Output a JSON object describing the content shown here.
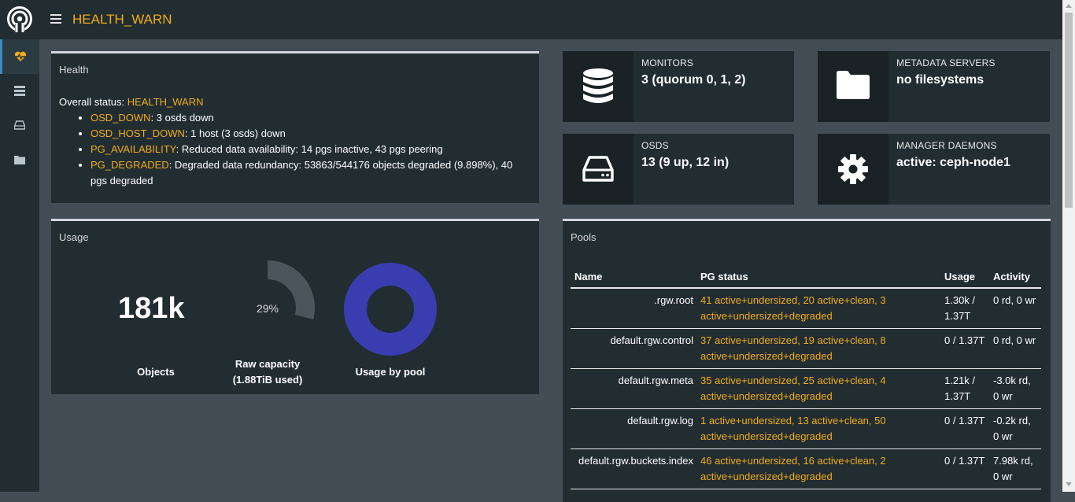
{
  "header": {
    "status": "HEALTH_WARN"
  },
  "sidebar": {
    "items": [
      {
        "name": "dashboard",
        "icon": "heartbeat-icon"
      },
      {
        "name": "servers",
        "icon": "server-icon"
      },
      {
        "name": "storage",
        "icon": "hdd-icon"
      },
      {
        "name": "filesystems",
        "icon": "folder-icon"
      }
    ]
  },
  "health": {
    "title": "Health",
    "overall_label": "Overall status: ",
    "overall_value": "HEALTH_WARN",
    "checks": [
      {
        "code": "OSD_DOWN",
        "message": ": 3 osds down"
      },
      {
        "code": "OSD_HOST_DOWN",
        "message": ": 1 host (3 osds) down"
      },
      {
        "code": "PG_AVAILABILITY",
        "message": ": Reduced data availability: 14 pgs inactive, 43 pgs peering"
      },
      {
        "code": "PG_DEGRADED",
        "message": ": Degraded data redundancy: 53863/544176 objects degraded (9.898%), 40 pgs degraded"
      }
    ]
  },
  "stats": {
    "monitors": {
      "label": "MONITORS",
      "value": "3 (quorum 0, 1, 2)"
    },
    "mds": {
      "label": "METADATA SERVERS",
      "value": "no filesystems"
    },
    "osds": {
      "label": "OSDS",
      "value": "13 (9 up, 12 in)"
    },
    "mgr": {
      "label": "MANAGER DAEMONS",
      "value": "active: ceph-node1"
    }
  },
  "usage": {
    "title": "Usage",
    "objects_value": "181k",
    "objects_label": "Objects",
    "raw_capacity_percent_text": "29%",
    "raw_capacity_fraction": 0.29,
    "raw_capacity_label_line1": "Raw capacity",
    "raw_capacity_label_line2": "(1.88TiB used)",
    "pool_label": "Usage by pool"
  },
  "pools": {
    "title": "Pools",
    "columns": [
      "Name",
      "PG status",
      "Usage",
      "Activity"
    ],
    "rows": [
      {
        "name": ".rgw.root",
        "pg": "41 active+undersized, 20 active+clean, 3 active+undersized+degraded",
        "usage": "1.30k / 1.37T",
        "activity": "0 rd, 0 wr"
      },
      {
        "name": "default.rgw.control",
        "pg": "37 active+undersized, 19 active+clean, 8 active+undersized+degraded",
        "usage": "0 / 1.37T",
        "activity": "0 rd, 0 wr"
      },
      {
        "name": "default.rgw.meta",
        "pg": "35 active+undersized, 25 active+clean, 4 active+undersized+degraded",
        "usage": "1.21k / 1.37T",
        "activity": "-3.0k rd, 0 wr"
      },
      {
        "name": "default.rgw.log",
        "pg": "1 active+undersized, 13 active+clean, 50 active+undersized+degraded",
        "usage": "0 / 1.37T",
        "activity": "-0.2k rd, 0 wr"
      },
      {
        "name": "default.rgw.buckets.index",
        "pg": "46 active+undersized, 16 active+clean, 2 active+undersized+degraded",
        "usage": "0 / 1.37T",
        "activity": "7.98k rd, 0 wr"
      }
    ]
  },
  "colors": {
    "warn": "#f0ad18",
    "accent": "#3c8dbc",
    "pool_donut": "#3a3db0",
    "panel": "#222d32"
  }
}
